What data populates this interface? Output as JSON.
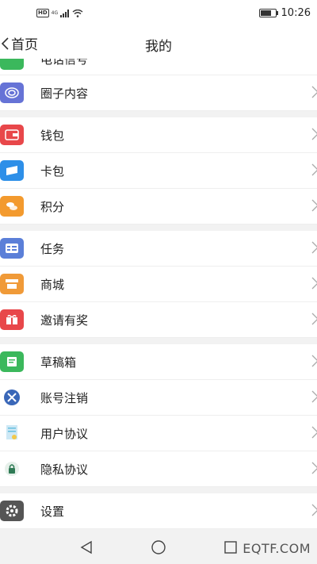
{
  "status_bar": {
    "hd": "HD",
    "network": "4G",
    "time": "10:26",
    "battery_level": 0.7
  },
  "header": {
    "back_label": "首页",
    "title": "我的"
  },
  "partial_row": {
    "label": "电话信号"
  },
  "sections": [
    {
      "items": [
        {
          "label": "圈子内容",
          "icon": "circle-swirl-icon",
          "color": "#6673d6"
        }
      ]
    },
    {
      "items": [
        {
          "label": "钱包",
          "icon": "wallet-icon",
          "color": "#e8474a"
        },
        {
          "label": "卡包",
          "icon": "card-icon",
          "color": "#2d8fe8"
        },
        {
          "label": "积分",
          "icon": "coins-icon",
          "color": "#f39a2e"
        }
      ]
    },
    {
      "items": [
        {
          "label": "任务",
          "icon": "task-icon",
          "color": "#5b7fd8"
        },
        {
          "label": "商城",
          "icon": "store-icon",
          "color": "#f09a38"
        },
        {
          "label": "邀请有奖",
          "icon": "gift-icon",
          "color": "#e8474a"
        }
      ]
    },
    {
      "items": [
        {
          "label": "草稿箱",
          "icon": "draft-icon",
          "color": "#3bb85c"
        },
        {
          "label": "账号注销",
          "icon": "cancel-account-icon",
          "color": "#3a67b8"
        },
        {
          "label": "用户协议",
          "icon": "agreement-icon",
          "color": "#66bfe0"
        },
        {
          "label": "隐私协议",
          "icon": "lock-icon",
          "color": "#2f7a55"
        }
      ]
    },
    {
      "items": [
        {
          "label": "设置",
          "icon": "gear-icon",
          "color": "#555555"
        }
      ]
    }
  ],
  "watermark": "EQTF.COM"
}
